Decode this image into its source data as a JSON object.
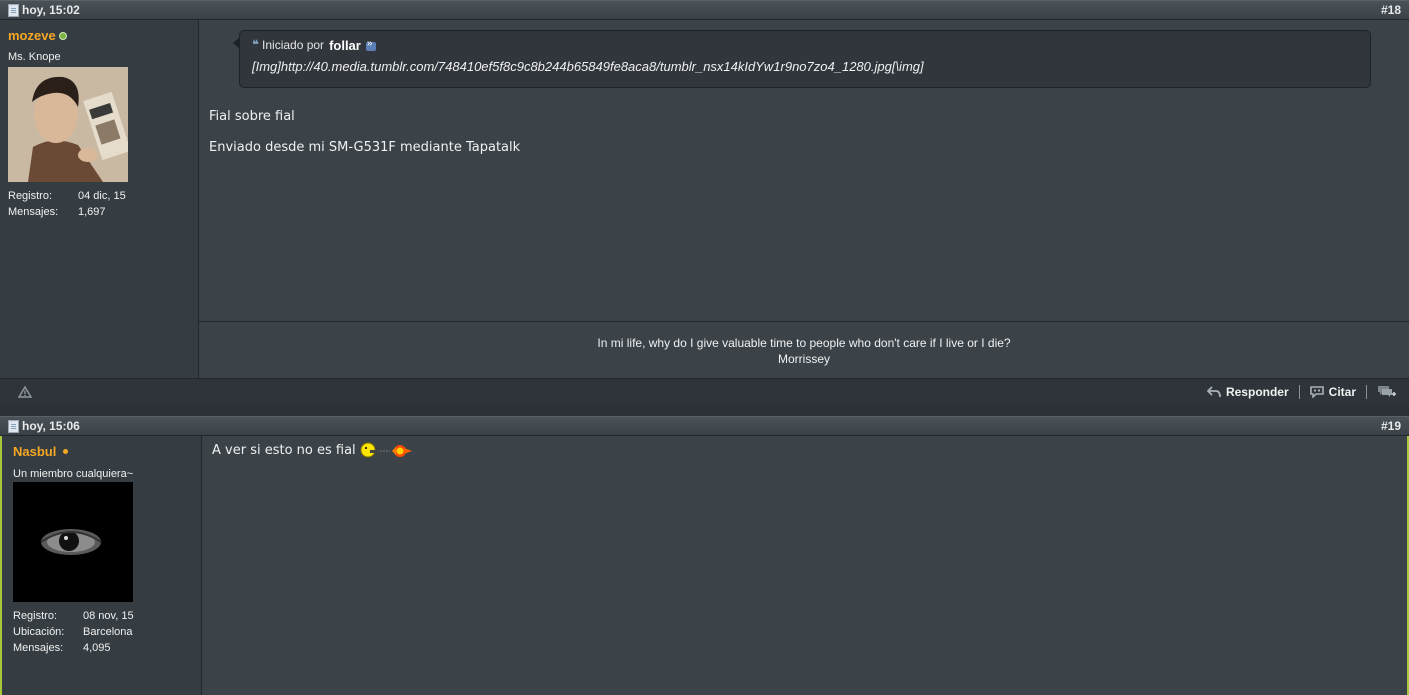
{
  "posts": [
    {
      "date": "hoy, 15:02",
      "number": "#18",
      "user": {
        "name": "mozeve",
        "title": "Ms. Knope",
        "online": true,
        "stats": [
          {
            "label": "Registro:",
            "value": "04 dic, 15"
          },
          {
            "label": "Mensajes:",
            "value": "1,697"
          }
        ]
      },
      "quote": {
        "prefix": "Iniciado por",
        "author": "follar",
        "text": "[Img]http://40.media.tumblr.com/748410ef5f8c9c8b244b65849fe8aca8/tumblr_nsx14kIdYw1r9no7zo4_1280.jpg[\\img]"
      },
      "message_lines": [
        "Fial sobre fial",
        "Enviado desde mi SM-G531F mediante Tapatalk"
      ],
      "signature": {
        "line1": "In mi life, why do I give valuable time to people who don't care if I live or I die?",
        "line2": "Morrissey"
      },
      "footer": {
        "reply": "Responder",
        "quote": "Citar"
      }
    },
    {
      "date": "hoy, 15:06",
      "number": "#19",
      "user": {
        "name": "Nasbul",
        "title": "Un miembro cualquiera~",
        "online": false,
        "stats": [
          {
            "label": "Registro:",
            "value": "08 nov, 15"
          },
          {
            "label": "Ubicación:",
            "value": "Barcelona"
          },
          {
            "label": "Mensajes:",
            "value": "4,095"
          }
        ]
      },
      "message": "A ver si esto no es fial"
    }
  ],
  "icons": {
    "report": "warning-triangle-icon",
    "reply": "reply-arrow-icon",
    "quote": "speech-bubble-icon",
    "multiquote": "multiquote-plus-icon",
    "smiley": "shooting-smiley-icon"
  },
  "colors": {
    "username": "#f5a623",
    "online": "#7cb342",
    "accent_edge": "#a6c83c"
  }
}
